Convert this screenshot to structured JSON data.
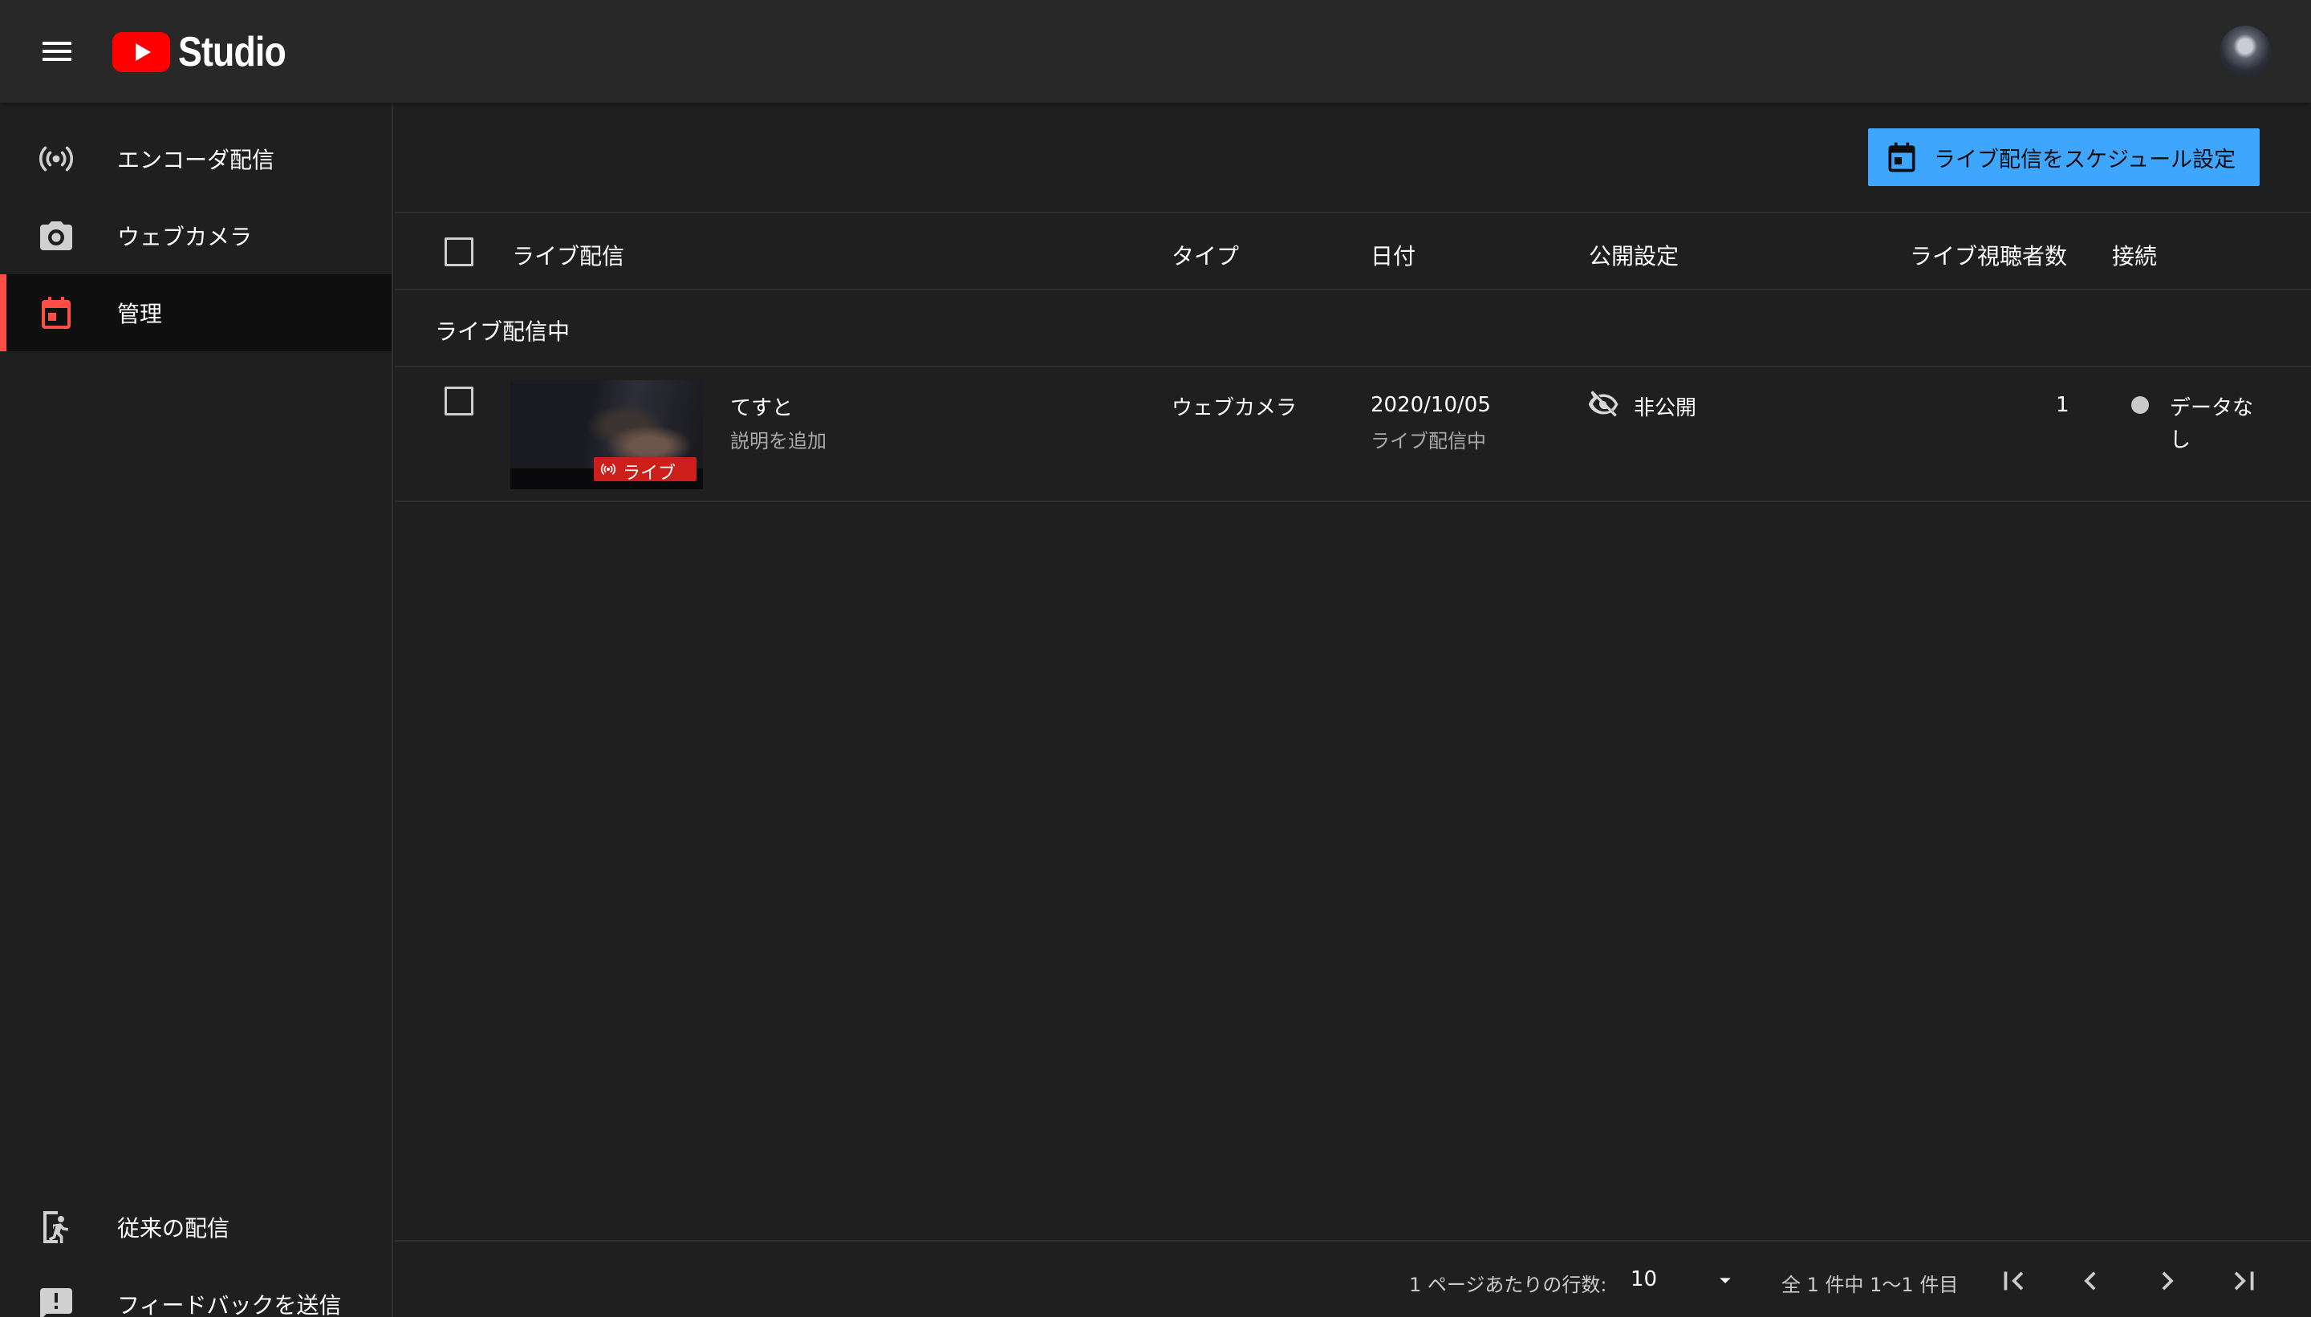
{
  "app": {
    "logo_text": "Studio"
  },
  "sidebar": {
    "items": [
      {
        "label": "エンコーダ配信",
        "icon": "broadcast-icon"
      },
      {
        "label": "ウェブカメラ",
        "icon": "camera-icon"
      },
      {
        "label": "管理",
        "icon": "calendar-icon",
        "active": true
      },
      {
        "label": "従来の配信",
        "icon": "exit-icon"
      },
      {
        "label": "フィードバックを送信",
        "icon": "feedback-icon"
      }
    ]
  },
  "toolbar": {
    "schedule_label": "ライブ配信をスケジュール設定"
  },
  "table": {
    "headers": {
      "stream": "ライブ配信",
      "type": "タイプ",
      "date": "日付",
      "visibility": "公開設定",
      "viewers": "ライブ視聴者数",
      "connection": "接続"
    },
    "section_label": "ライブ配信中",
    "rows": [
      {
        "title": "てすと",
        "description": "説明を追加",
        "badge": "ライブ",
        "type": "ウェブカメラ",
        "date": "2020/10/05",
        "date_status": "ライブ配信中",
        "visibility": "非公開",
        "viewers": "1",
        "connection_line1": "データな",
        "connection_line2": "し"
      }
    ]
  },
  "pagination": {
    "rows_per_page_label": "1 ページあたりの行数:",
    "rows_per_page_value": "10",
    "range_label": "全 1 件中 1〜1 件目"
  },
  "colors": {
    "accent": "#ff4e45",
    "button": "#3ea6ff",
    "live_badge": "#cc1f1a",
    "background": "#1f1f1f",
    "header": "#282828"
  }
}
